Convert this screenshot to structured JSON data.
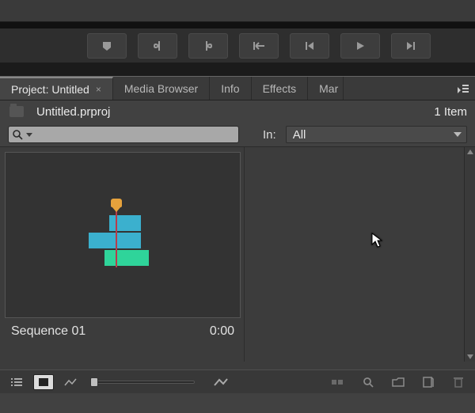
{
  "tabs": {
    "project": "Project: Untitled",
    "media_browser": "Media Browser",
    "info": "Info",
    "effects": "Effects",
    "markers_trunc": "Mar"
  },
  "project": {
    "filename": "Untitled.prproj",
    "item_count": "1 Item"
  },
  "filter": {
    "in_label": "In:",
    "in_value": "All",
    "search_placeholder": ""
  },
  "items": [
    {
      "name": "Sequence 01",
      "duration": "0:00"
    }
  ]
}
